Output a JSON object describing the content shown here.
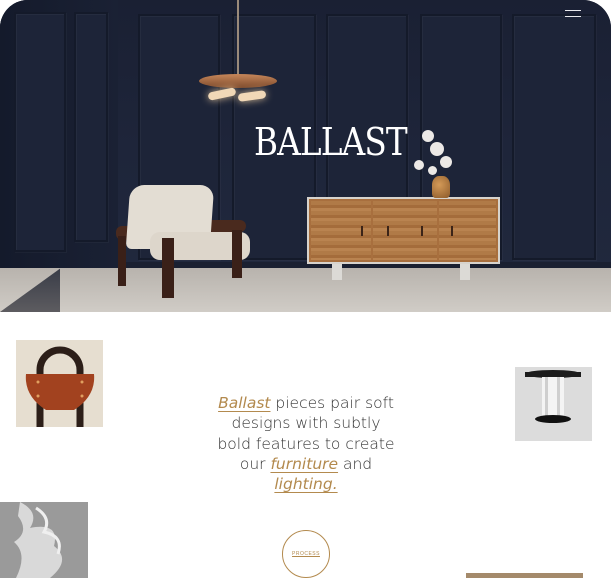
{
  "header": {
    "logo_text": "BALLAST",
    "menu_icon": "hamburger-menu-icon"
  },
  "intro": {
    "brand_link": "Ballast",
    "text_part1": " pieces pair soft designs with subtly bold features to create our ",
    "furniture_link": "furniture",
    "text_part2": " and ",
    "lighting_link": "lighting."
  },
  "process_button": "PROCESS",
  "colors": {
    "accent": "#b38a4e",
    "hero_wall": "#1e253a",
    "text": "#333333"
  }
}
